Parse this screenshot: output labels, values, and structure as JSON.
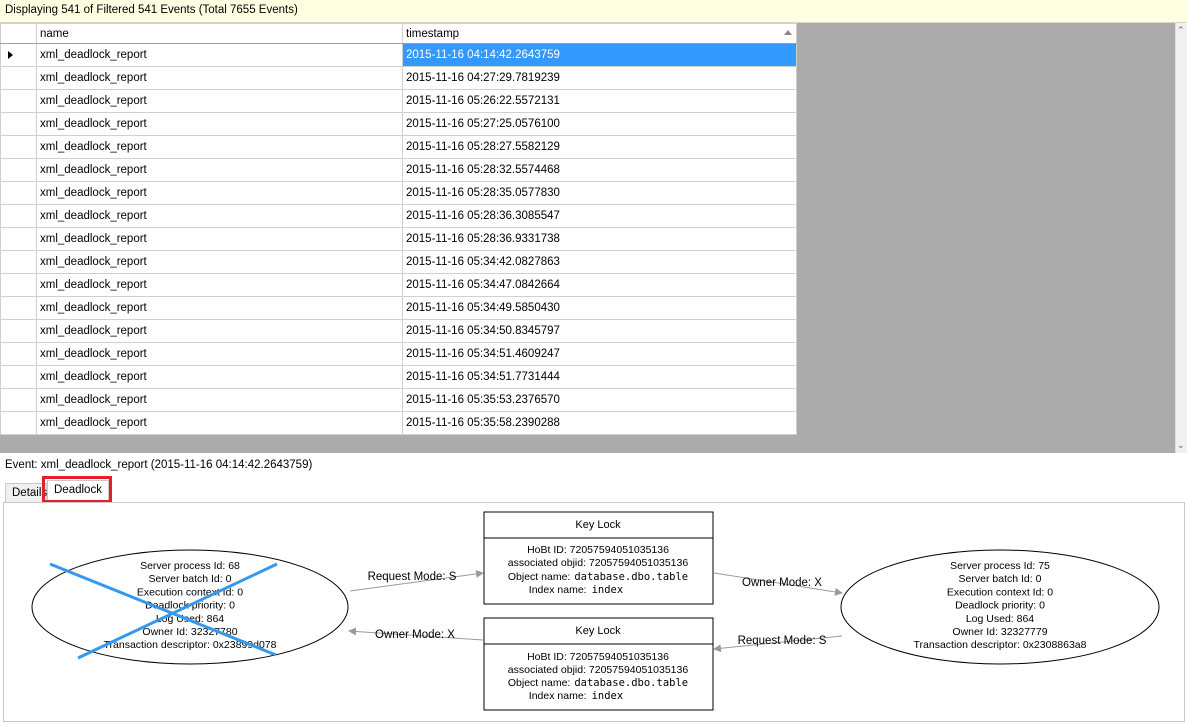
{
  "status": {
    "text": "Displaying 541 of Filtered 541 Events (Total 7655 Events)"
  },
  "grid": {
    "columns": [
      "name",
      "timestamp"
    ],
    "rows": [
      {
        "name": "xml_deadlock_report",
        "timestamp": "2015-11-16 04:14:42.2643759"
      },
      {
        "name": "xml_deadlock_report",
        "timestamp": "2015-11-16 04:27:29.7819239"
      },
      {
        "name": "xml_deadlock_report",
        "timestamp": "2015-11-16 05:26:22.5572131"
      },
      {
        "name": "xml_deadlock_report",
        "timestamp": "2015-11-16 05:27:25.0576100"
      },
      {
        "name": "xml_deadlock_report",
        "timestamp": "2015-11-16 05:28:27.5582129"
      },
      {
        "name": "xml_deadlock_report",
        "timestamp": "2015-11-16 05:28:32.5574468"
      },
      {
        "name": "xml_deadlock_report",
        "timestamp": "2015-11-16 05:28:35.0577830"
      },
      {
        "name": "xml_deadlock_report",
        "timestamp": "2015-11-16 05:28:36.3085547"
      },
      {
        "name": "xml_deadlock_report",
        "timestamp": "2015-11-16 05:28:36.9331738"
      },
      {
        "name": "xml_deadlock_report",
        "timestamp": "2015-11-16 05:34:42.0827863"
      },
      {
        "name": "xml_deadlock_report",
        "timestamp": "2015-11-16 05:34:47.0842664"
      },
      {
        "name": "xml_deadlock_report",
        "timestamp": "2015-11-16 05:34:49.5850430"
      },
      {
        "name": "xml_deadlock_report",
        "timestamp": "2015-11-16 05:34:50.8345797"
      },
      {
        "name": "xml_deadlock_report",
        "timestamp": "2015-11-16 05:34:51.4609247"
      },
      {
        "name": "xml_deadlock_report",
        "timestamp": "2015-11-16 05:34:51.7731444"
      },
      {
        "name": "xml_deadlock_report",
        "timestamp": "2015-11-16 05:35:53.2376570"
      },
      {
        "name": "xml_deadlock_report",
        "timestamp": "2015-11-16 05:35:58.2390288"
      }
    ],
    "selected_index": 0
  },
  "event": {
    "label": "Event: xml_deadlock_report (2015-11-16 04:14:42.2643759)"
  },
  "tabs": [
    {
      "label": "Details",
      "active": false
    },
    {
      "label": "Deadlock",
      "active": true
    }
  ],
  "deadlock": {
    "process_left": {
      "lines": [
        "Server process Id: 68",
        "Server batch Id: 0",
        "Execution context Id: 0",
        "Deadlock priority: 0",
        "Log Used: 864",
        "Owner Id: 32327780",
        "Transaction descriptor: 0x23899d078"
      ],
      "victim": true
    },
    "process_right": {
      "lines": [
        "Server process Id: 75",
        "Server batch Id: 0",
        "Execution context Id: 0",
        "Deadlock priority: 0",
        "Log Used: 864",
        "Owner Id: 32327779",
        "Transaction descriptor: 0x2308863a8"
      ],
      "victim": false
    },
    "lock_top": {
      "title": "Key Lock",
      "hobt": "HoBt ID: 72057594051035136",
      "objid": "associated objid: 72057594051035136",
      "object_label": "Object name:",
      "object_value": "database.dbo.table",
      "index_label": "Index name:",
      "index_value": "index"
    },
    "lock_bottom": {
      "title": "Key Lock",
      "hobt": "HoBt ID: 72057594051035136",
      "objid": "associated objid: 72057594051035136",
      "object_label": "Object name:",
      "object_value": "database.dbo.table",
      "index_label": "Index name:",
      "index_value": "index"
    },
    "edges": {
      "left_to_top": "Request Mode: S",
      "top_to_right": "Owner Mode: X",
      "right_to_bottom": "Request Mode: S",
      "bottom_to_left": "Owner Mode: X"
    }
  },
  "colors": {
    "selection": "#3399ff",
    "highlight": "#e0202a",
    "victim_cross": "#3399ee"
  }
}
